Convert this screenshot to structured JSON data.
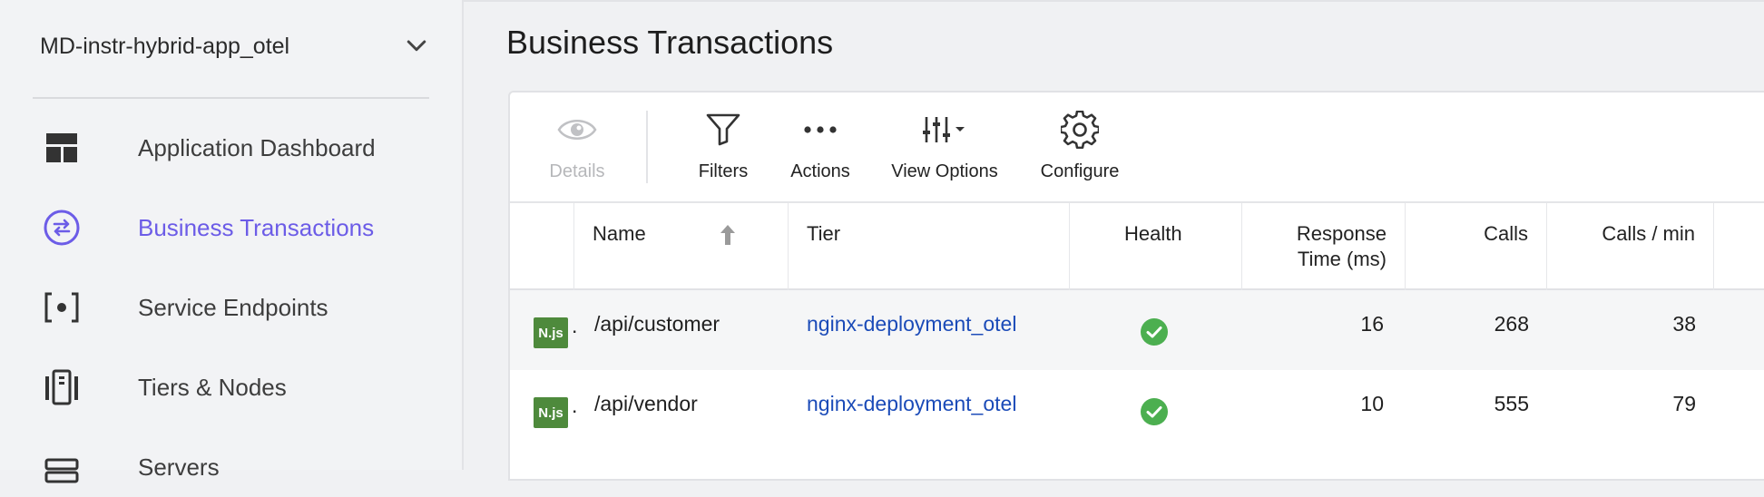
{
  "sidebar": {
    "app_name": "MD-instr-hybrid-app_otel",
    "items": [
      {
        "label": "Application Dashboard",
        "icon": "dashboard-icon"
      },
      {
        "label": "Business Transactions",
        "icon": "transactions-icon",
        "active": true
      },
      {
        "label": "Service Endpoints",
        "icon": "service-endpoints-icon"
      },
      {
        "label": "Tiers & Nodes",
        "icon": "tiers-nodes-icon"
      },
      {
        "label": "Servers",
        "icon": "servers-icon"
      }
    ]
  },
  "main": {
    "title": "Business Transactions",
    "toolbar": {
      "details": "Details",
      "filters": "Filters",
      "actions": "Actions",
      "view_options": "View Options",
      "configure": "Configure"
    },
    "table": {
      "columns": {
        "name": "Name",
        "tier": "Tier",
        "health": "Health",
        "response_time_1": "Response",
        "response_time_2": "Time (ms)",
        "calls": "Calls",
        "calls_min": "Calls / min"
      },
      "rows": [
        {
          "badge": "N.js",
          "name": "/api/customer",
          "tier": "nginx-deployment_otel",
          "health": "healthy",
          "response_time": "16",
          "calls": "268",
          "calls_min": "38"
        },
        {
          "badge": "N.js",
          "name": "/api/vendor",
          "tier": "nginx-deployment_otel",
          "health": "healthy",
          "response_time": "10",
          "calls": "555",
          "calls_min": "79"
        }
      ]
    }
  },
  "colors": {
    "accent": "#6c5ce7",
    "link": "#1b4bb8",
    "healthy": "#4caf50",
    "node_badge": "#4e8a3c"
  }
}
